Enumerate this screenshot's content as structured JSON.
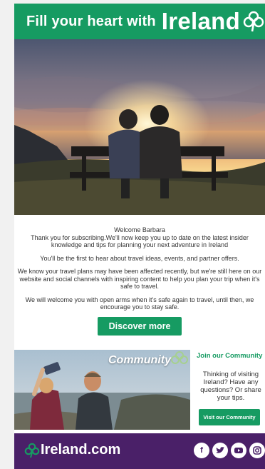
{
  "header": {
    "tagline": "Fill your heart with",
    "brand": "Ireland"
  },
  "hero": {
    "alt_icon": "sunset-couple-bench-image"
  },
  "body": {
    "greeting": "Welcome Barbara",
    "line1": "Thank you for subscribing.We'll now keep you up to date on the latest insider knowledge and tips for planning your next adventure in Ireland",
    "line2": "You'll be the first to hear about travel ideas, events, and partner offers.",
    "line3": "We know your travel plans may have been affected recently, but we're still here on our website and social channels with inspiring content to help you plan your trip when it's safe to travel.",
    "line4": "We will welcome you with open arms when it's safe again to travel, until then, we encourage you to stay safe.",
    "cta_label": "Discover more"
  },
  "community": {
    "photo_caption": "Community",
    "title": "Join our Community",
    "desc": "Thinking of visiting Ireland? Have any questions? Or share your tips.",
    "button_label": "Visit our Community"
  },
  "footer": {
    "brand": "Ireland.com",
    "social": [
      "facebook-icon",
      "twitter-icon",
      "youtube-icon",
      "instagram-icon"
    ]
  },
  "colors": {
    "green": "#169b62",
    "purple": "#4a2068"
  }
}
